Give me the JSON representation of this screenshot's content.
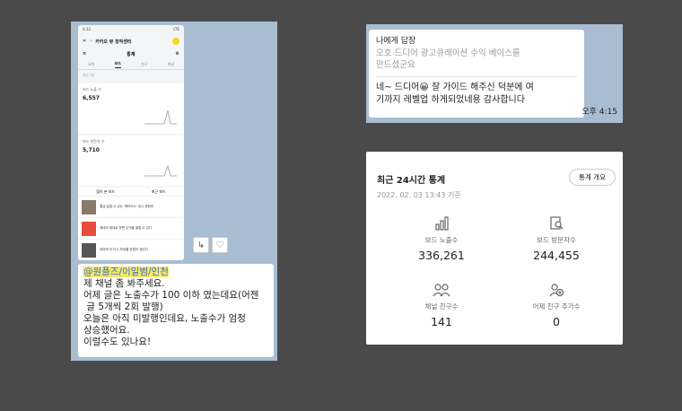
{
  "left_chat": {
    "phone": {
      "status_time": "4:12",
      "status_right": "LTE",
      "title": "카카오 뷰 창작센터",
      "subtitle": "통계",
      "tabs": [
        "요약",
        "보드",
        "친구",
        "채널"
      ],
      "date": "최근 7일",
      "card1_label": "보드 노출 수",
      "card1_value": "6,557",
      "card2_label": "보드 방문자 수",
      "card2_value": "5,710",
      "list_tabs": [
        "많이 본 보드",
        "최근 보드"
      ],
      "items": [
        "월급 늘릴 수 있는 '레이어스' 유니 총정리",
        "재테크 제대로 하면 수익을 올릴 수 있다",
        "네이버 더 다시 보내줄 방법이 생긴다"
      ]
    },
    "share_icon": "↳",
    "heart_icon": "♡",
    "message": {
      "mention": "@원플즈/이일범/인천",
      "lines": [
        "제 채널 좀 봐주세요.",
        "어제 글은 노출수가 100 이하 였는데요(어젠",
        " 글 5개씩 2회 발행)",
        "오늘은 아직 미발행인데요, 노출수가 엄청",
        "상승했어요.",
        "이럴수도 있나요!"
      ]
    }
  },
  "right_chat": {
    "reply_label": "나에게 답장",
    "quote_lines": [
      "오호 드디어 광고큐레이션 수익 베이스를",
      "만드셨군요"
    ],
    "reply_lines": [
      "네~ 드디어😀 잘 가이드 해주신 덕분에 여",
      "기까지 레벨업 하게되었네용 감사합니다"
    ],
    "time": "오후 4:15"
  },
  "stats": {
    "title": "최근 24시간 통계",
    "date": "2022. 02. 03 13:43 기준",
    "button": "통계 개요",
    "items": [
      {
        "icon": "bar-chart-icon",
        "label": "보드 노출수",
        "value": "336,261"
      },
      {
        "icon": "visitor-icon",
        "label": "보드 방문자수",
        "value": "244,455"
      },
      {
        "icon": "friends-icon",
        "label": "채널 친구수",
        "value": "141"
      },
      {
        "icon": "add-friend-icon",
        "label": "어제 친구 추가수",
        "value": "0"
      }
    ]
  }
}
